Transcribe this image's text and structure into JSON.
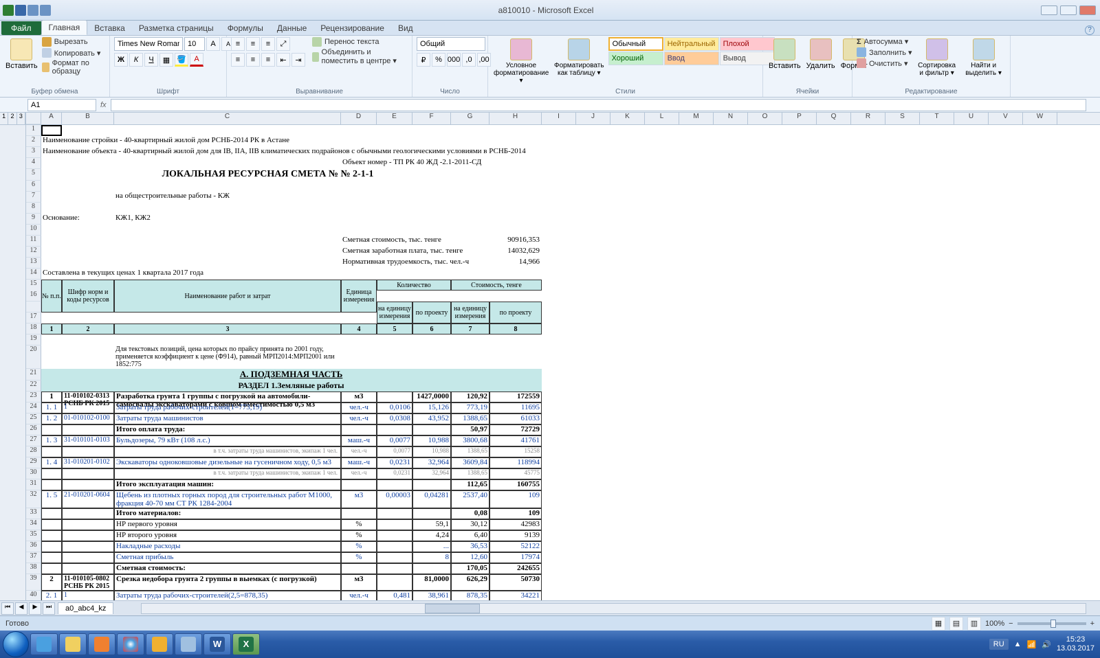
{
  "app": {
    "title": "a810010 - Microsoft Excel"
  },
  "tabs": {
    "file": "Файл",
    "home": "Главная",
    "insert": "Вставка",
    "layout": "Разметка страницы",
    "formulas": "Формулы",
    "data": "Данные",
    "review": "Рецензирование",
    "view": "Вид"
  },
  "ribbon": {
    "clipboard": {
      "label": "Буфер обмена",
      "paste": "Вставить",
      "cut": "Вырезать",
      "copy": "Копировать ▾",
      "format": "Формат по образцу"
    },
    "font": {
      "label": "Шрифт",
      "name": "Times New Roman",
      "size": "10"
    },
    "align": {
      "label": "Выравнивание",
      "wrap": "Перенос текста",
      "merge": "Объединить и поместить в центре ▾"
    },
    "number": {
      "label": "Число",
      "format": "Общий"
    },
    "styles": {
      "label": "Стили",
      "cond": "Условное форматирование ▾",
      "table": "Форматировать как таблицу ▾",
      "normal": "Обычный",
      "neutral": "Нейтральный",
      "bad": "Плохой",
      "good": "Хороший",
      "input": "Ввод",
      "output": "Вывод"
    },
    "cells": {
      "label": "Ячейки",
      "insert": "Вставить",
      "delete": "Удалить",
      "format": "Формат"
    },
    "editing": {
      "label": "Редактирование",
      "autosum": "Автосумма ▾",
      "fill": "Заполнить ▾",
      "clear": "Очистить ▾",
      "sort": "Сортировка и фильтр ▾",
      "find": "Найти и выделить ▾"
    }
  },
  "namebox": {
    "cell": "A1",
    "formula": ""
  },
  "cols": [
    "A",
    "B",
    "C",
    "D",
    "E",
    "F",
    "G",
    "H",
    "I",
    "J",
    "K",
    "L",
    "M",
    "N",
    "O",
    "P",
    "Q",
    "R",
    "S",
    "T",
    "U",
    "V",
    "W"
  ],
  "doc": {
    "r2": "Наименование стройки -   40-квартирный жилой дом РСНБ-2014 РК в Астане",
    "r3": "Наименование объекта -   40-квартирный жилой дом для IВ, IIА, IIВ климатических подрайонов с обычными геологическими условиями в РСНБ-2014",
    "r4": "Объект номер -   ТП РК 40 ЖД -2.1-2011-СД",
    "r5": "ЛОКАЛЬНАЯ   РЕСУРСНАЯ   СМЕТА    №  № 2-1-1",
    "r7": "на   общестроительные работы - КЖ",
    "r9a": "Основание:",
    "r9b": "КЖ1, КЖ2",
    "r11a": "Сметная стоимость, тыс. тенге",
    "r11b": "90916,353",
    "r12a": "Сметная заработная плата, тыс. тенге",
    "r12b": "14032,629",
    "r13a": "Нормативная трудоемкость, тыс. чел.-ч",
    "r13b": "14,966",
    "r14": "Составлена в текущих ценах 1 квартала 2017 года",
    "hdr": {
      "c1": "№ п.п.",
      "c2": "Шифр норм и коды ресурсов",
      "c3": "Наименование работ и затрат",
      "c4": "Единица измерения",
      "c5": "Количество",
      "c6": "Стоимость, тенге",
      "c5a": "на единицу измерения",
      "c5b": "по проекту",
      "c6a": "на единицу измерения",
      "c6b": "по проекту"
    },
    "note": "Для текстовых позиций, цена которых по прайсу принята по 2001 году, применяется коэффициент к цене (Ф914), равный МРП2014:МРП2001 или 1852:775",
    "sectA": "А. ПОДЗЕМНАЯ ЧАСТЬ",
    "sect1": "РАЗДЕЛ 1.Земляные работы"
  },
  "rows": [
    {
      "n": "1",
      "code": "11-010102-0313 РСНБ РК 2015",
      "name": "Разработка грунта 1 группы с погрузкой на автомобили-самосвалы экскаваторами с ковшом вместимостью 0,5 м3",
      "u": "м3",
      "q": "1427,0000",
      "p": "120,92",
      "s": "172559",
      "bold": true
    },
    {
      "n": "1. 1",
      "code": "1",
      "name": "Затраты труда рабочих-строителей(1=773,19)",
      "u": "чел.-ч",
      "q1": "0,0106",
      "q": "15,126",
      "p": "773,19",
      "s": "11695",
      "blue": true
    },
    {
      "n": "1. 2",
      "code": "01-010102-0100",
      "name": "Затраты труда машинистов",
      "u": "чел.-ч",
      "q1": "0,0308",
      "q": "43,952",
      "p": "1388,65",
      "s": "61033",
      "blue": true
    },
    {
      "name": "Итого оплата труда:",
      "p": "50,97",
      "s": "72729",
      "bold": true
    },
    {
      "n": "1. 3",
      "code": "31-010101-0103",
      "name": "Бульдозеры, 79 кВт (108 л.с.)",
      "u": "маш.-ч",
      "q1": "0,0077",
      "q": "10,988",
      "p": "3800,68",
      "s": "41761",
      "blue": true
    },
    {
      "name": "в т.ч. затраты труда машинистов, экипаж 1 чел.",
      "u": "чел.-ч",
      "q1": "0,0077",
      "q": "10,988",
      "p": "1388,65",
      "s": "15258",
      "gray": true
    },
    {
      "n": "1. 4",
      "code": "31-010201-0102",
      "name": "Экскаваторы одноковшовые дизельные на гусеничном ходу, 0,5 м3",
      "u": "маш.-ч",
      "q1": "0,0231",
      "q": "32,964",
      "p": "3609,84",
      "s": "118994",
      "blue": true
    },
    {
      "name": "в т.ч. затраты труда машинистов, экипаж 1 чел.",
      "u": "чел.-ч",
      "q1": "0,0231",
      "q": "32,964",
      "p": "1388,65",
      "s": "45775",
      "gray": true
    },
    {
      "name": "Итого эксплуатация машин:",
      "p": "112,65",
      "s": "160755",
      "bold": true
    },
    {
      "n": "1. 5",
      "code": "21-010201-0604",
      "name": "Щебень из плотных горных пород для строительных работ М1000, фракция 40-70 мм СТ РК 1284-2004",
      "u": "м3",
      "q1": "0,00003",
      "q": "0,04281",
      "p": "2537,40",
      "s": "109",
      "blue": true,
      "tall": true
    },
    {
      "name": "Итого материалов:",
      "p": "0,08",
      "s": "109",
      "bold": true
    },
    {
      "name": "НР первого уровня",
      "u": "%",
      "q": "59,1",
      "p": "30,12",
      "s": "42983"
    },
    {
      "name": "НР второго уровня",
      "u": "%",
      "q": "4,24",
      "p": "6,40",
      "s": "9139"
    },
    {
      "name": "Накладные расходы",
      "u": "%",
      "q": "...",
      "p": "36,53",
      "s": "52122",
      "blue": true
    },
    {
      "name": "Сметная прибыль",
      "u": "%",
      "q": "8",
      "p": "12,60",
      "s": "17974",
      "blue": true
    },
    {
      "name": "Сметная стоимость:",
      "p": "170,05",
      "s": "242655",
      "bold": true
    },
    {
      "n": "2",
      "code": "11-010105-0802 РСНБ РК 2015",
      "name": "Срезка недобора грунта 2 группы в выемках (с погрузкой)",
      "u": "м3",
      "q": "81,0000",
      "p": "626,29",
      "s": "50730",
      "bold": true,
      "tall": true
    },
    {
      "n": "2. 1",
      "code": "1",
      "name": "Затраты труда рабочих-строителей(2,5=878,35)",
      "u": "чел.-ч",
      "q1": "0,481",
      "q": "38,961",
      "p": "878,35",
      "s": "34221",
      "blue": true
    }
  ],
  "colnums": [
    "1",
    "2",
    "3",
    "4",
    "5",
    "6",
    "7",
    "8"
  ],
  "sheettab": "a0_abc4_kz",
  "status": {
    "ready": "Готово",
    "zoom": "100%"
  },
  "tray": {
    "lang": "RU",
    "time": "15:23",
    "date": "13.03.2017"
  }
}
